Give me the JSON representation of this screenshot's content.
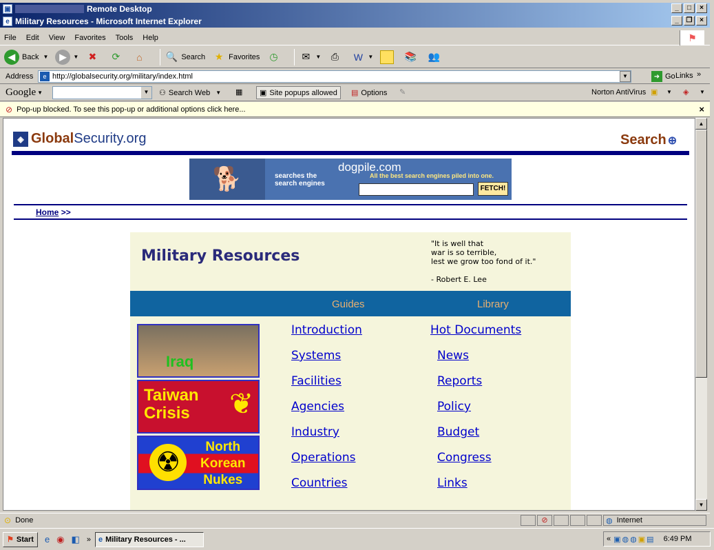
{
  "rd_title": "Remote Desktop",
  "ie_title": "Military Resources - Microsoft Internet Explorer",
  "menu": [
    "File",
    "Edit",
    "View",
    "Favorites",
    "Tools",
    "Help"
  ],
  "toolbar": {
    "back": "Back",
    "search": "Search",
    "favorites": "Favorites"
  },
  "address": {
    "label": "Address",
    "url": "http://globalsecurity.org/military/index.html",
    "go": "Go",
    "links": "Links"
  },
  "google": {
    "logo": "Google",
    "search_web": "Search Web",
    "popups": "Site popups allowed",
    "options": "Options",
    "norton": "Norton AntiVirus"
  },
  "popup": {
    "text": "Pop-up blocked. To see this pop-up or additional options click here..."
  },
  "site": {
    "logo_bold": "Global",
    "logo_rest": "Security.org",
    "search_label": "Search",
    "ad": {
      "brand": "dogpile.com",
      "tagline": "All the best search engines piled into one.",
      "left_text": "searches the\nsearch engines",
      "button": "FETCH!"
    },
    "breadcrumb": {
      "home": "Home",
      "sep": ">>"
    },
    "heading": "Military Resources",
    "quote": "\"It is well that\nwar is so terrible,\nlest we grow too fond of it.\"\n\n- Robert E. Lee",
    "nav": {
      "guides": "Guides",
      "library": "Library"
    },
    "guides": [
      "Introduction",
      "Systems",
      "Facilities",
      "Agencies",
      "Industry",
      "Operations",
      "Countries"
    ],
    "library": [
      "Hot Documents",
      "News",
      "Reports",
      "Policy",
      "Budget",
      "Congress",
      "Links"
    ],
    "banners": {
      "iraq": "Iraq",
      "taiwan": "Taiwan\nCrisis",
      "korea": "North\nKorean\nNukes"
    }
  },
  "status": {
    "text": "Done",
    "zone": "Internet"
  },
  "taskbar": {
    "start": "Start",
    "task": "Military Resources - ...",
    "clock": "6:49 PM"
  }
}
